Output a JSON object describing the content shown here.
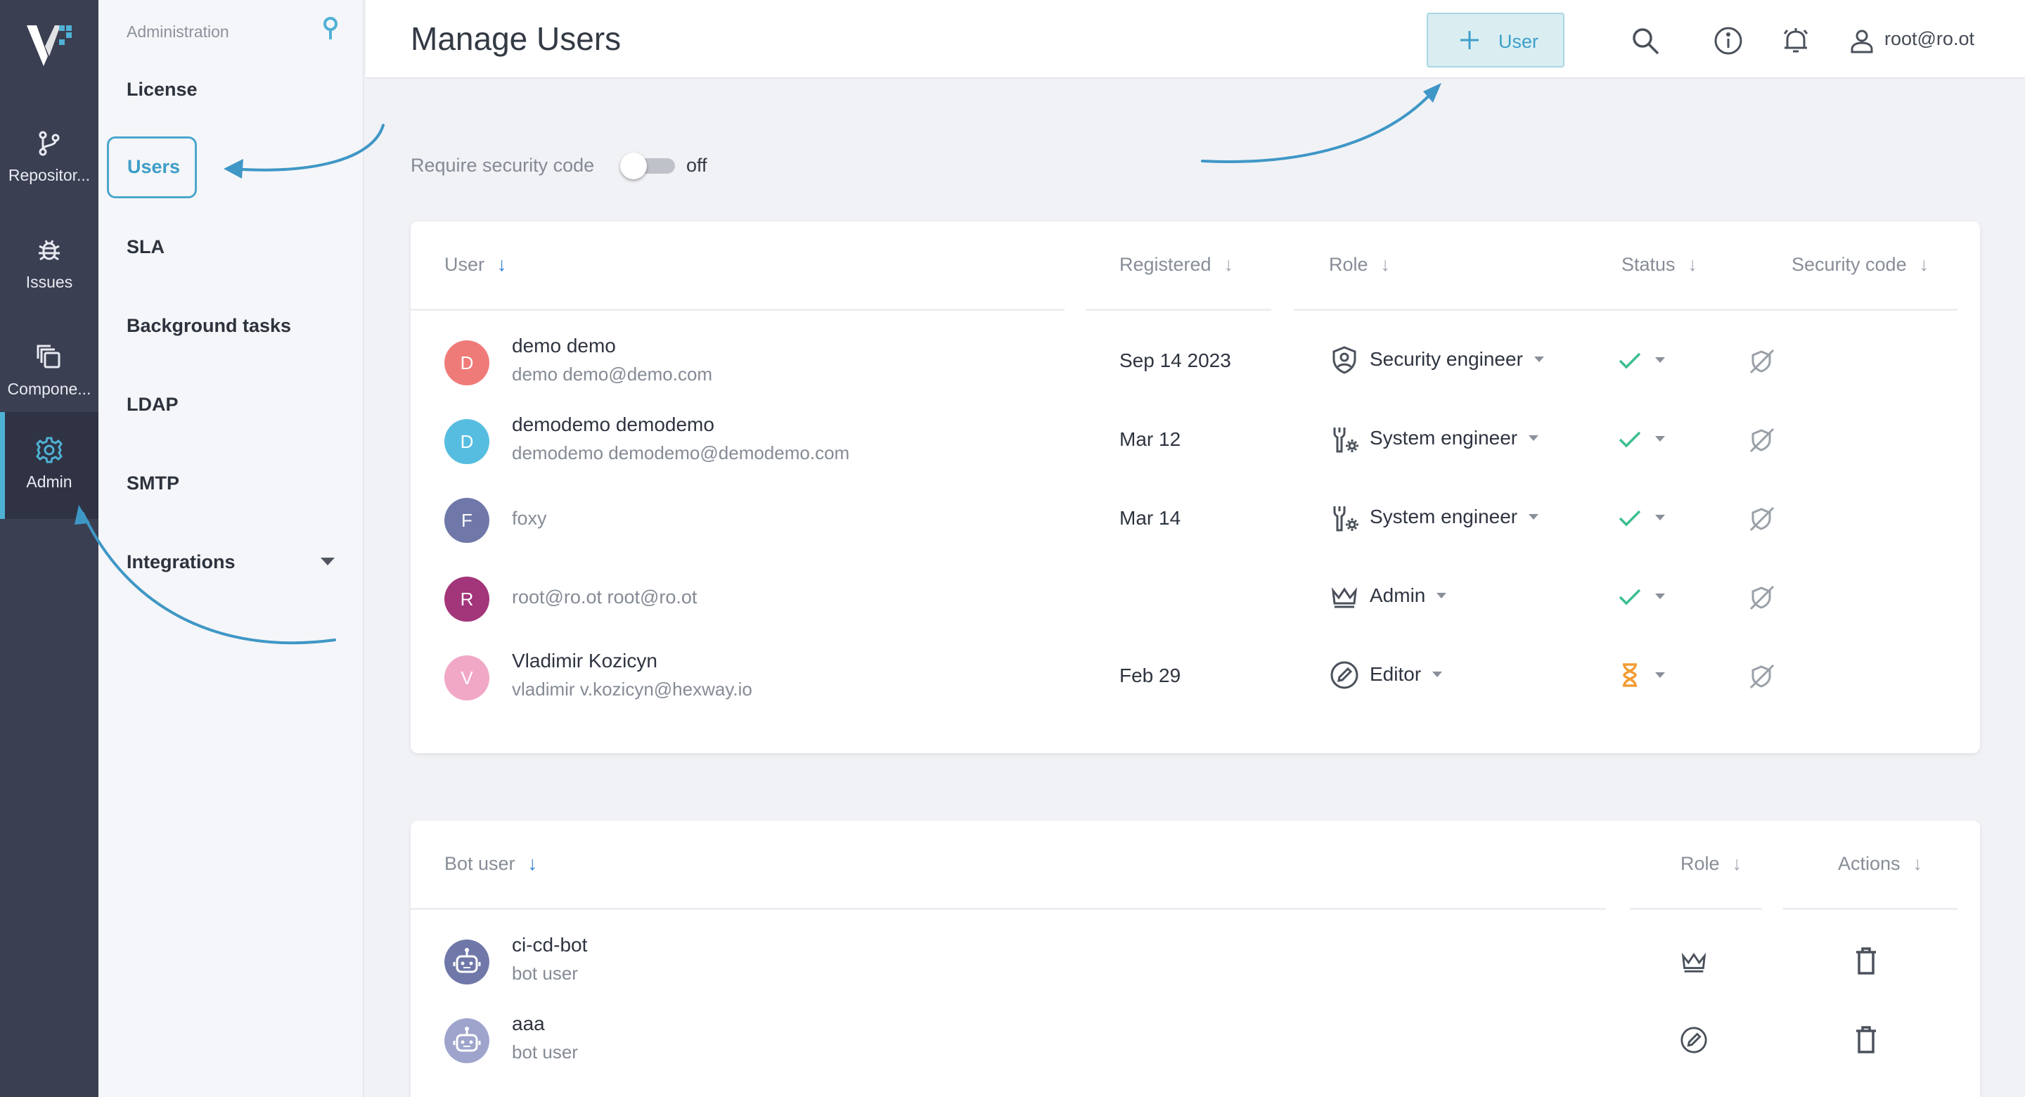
{
  "rail": {
    "items": [
      {
        "label": "Repositor...",
        "icon": "branch-icon"
      },
      {
        "label": "Issues",
        "icon": "bug-icon"
      },
      {
        "label": "Compone...",
        "icon": "components-icon"
      },
      {
        "label": "Admin",
        "icon": "gear-icon"
      }
    ],
    "active": "Admin"
  },
  "sidebar": {
    "heading": "Administration",
    "items": [
      {
        "label": "License"
      },
      {
        "label": "Users"
      },
      {
        "label": "SLA"
      },
      {
        "label": "Background tasks"
      },
      {
        "label": "LDAP"
      },
      {
        "label": "SMTP"
      },
      {
        "label": "Integrations"
      }
    ],
    "active": "Users"
  },
  "header": {
    "title": "Manage Users",
    "add_user_label": "User",
    "account": "root@ro.ot"
  },
  "security": {
    "label": "Require security code",
    "state": "off"
  },
  "users_table": {
    "columns": [
      "User",
      "Registered",
      "Role",
      "Status",
      "Security code"
    ],
    "rows": [
      {
        "initial": "D",
        "avatar_color": "#ef7b78",
        "name": "demo demo",
        "email": "demo demo@demo.com",
        "registered": "Sep 14 2023",
        "role": "Security engineer",
        "role_icon": "shield-user-icon",
        "status": "active",
        "status_icon": "check-icon"
      },
      {
        "initial": "D",
        "avatar_color": "#56bde0",
        "name": "demodemo demodemo",
        "email": "demodemo demodemo@demodemo.com",
        "registered": "Mar 12",
        "role": "System engineer",
        "role_icon": "wrench-gear-icon",
        "status": "active",
        "status_icon": "check-icon"
      },
      {
        "initial": "F",
        "avatar_color": "#6f78a8",
        "name": "foxy",
        "email": "",
        "registered": "Mar 14",
        "role": "System engineer",
        "role_icon": "wrench-gear-icon",
        "status": "active",
        "status_icon": "check-icon"
      },
      {
        "initial": "R",
        "avatar_color": "#a3357a",
        "name": "root@ro.ot root@ro.ot",
        "email": "",
        "registered": "",
        "role": "Admin",
        "role_icon": "crown-icon",
        "status": "active",
        "status_icon": "check-icon"
      },
      {
        "initial": "V",
        "avatar_color": "#f1a7c6",
        "name": "Vladimir Kozicyn",
        "email": "vladimir v.kozicyn@hexway.io",
        "registered": "Feb 29",
        "role": "Editor",
        "role_icon": "pencil-circle-icon",
        "status": "pending",
        "status_icon": "hourglass-icon"
      }
    ]
  },
  "bots_table": {
    "columns": [
      "Bot user",
      "Role",
      "Actions"
    ],
    "rows": [
      {
        "name": "ci-cd-bot",
        "type": "bot user",
        "avatar_color": "#6f78a8",
        "role_icon": "crown-icon"
      },
      {
        "name": "aaa",
        "type": "bot user",
        "avatar_color": "#9ea4cc",
        "role_icon": "pencil-circle-icon"
      }
    ]
  },
  "colors": {
    "accent": "#4aa7cd",
    "rail_bg": "#3b3f52",
    "check": "#3bbf8f",
    "pending": "#f39c33"
  }
}
